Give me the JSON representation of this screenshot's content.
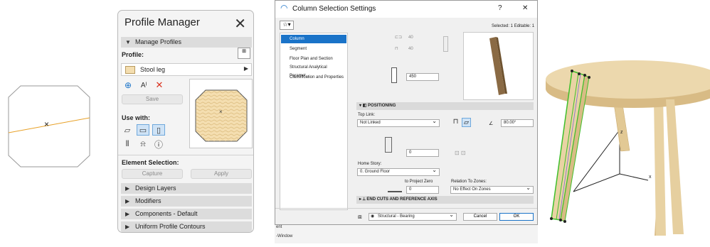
{
  "left_canvas": {
    "marker": "×"
  },
  "profile_manager": {
    "title": "Profile Manager",
    "manage_profiles": "Manage Profiles",
    "profile_label": "Profile:",
    "profile_name": "Stool leg",
    "save_label": "Save",
    "use_with_label": "Use with:",
    "element_selection_label": "Element Selection:",
    "capture_label": "Capture",
    "apply_label": "Apply",
    "sections": [
      "Design Layers",
      "Modifiers",
      "Components - Default",
      "Uniform Profile Contours"
    ],
    "preview_marker": "×"
  },
  "column_settings": {
    "title": "Column Selection Settings",
    "help": "?",
    "close": "✕",
    "selected_info": "Selected: 1 Editable: 1",
    "nav": [
      "Column",
      "Segment",
      "Floor Plan and Section",
      "Structural Analytical Paramet...",
      "Classification and Properties"
    ],
    "dim_a": "40",
    "dim_b": "40",
    "height_value": "450",
    "positioning_label": "POSITIONING",
    "top_link_label": "Top Link:",
    "top_link_value": "Not Linked",
    "angle_value": "80.00°",
    "bottom_offset": "0",
    "home_story_label": "Home Story:",
    "home_story_value": "0. Ground Floor",
    "to_project_zero": "to Project Zero",
    "project_zero_value": "0",
    "relation_label": "Relation To Zones:",
    "relation_value": "No Effect On Zones",
    "end_cuts_label": "END CUTS AND REFERENCE AXIS",
    "structural_value": "Structural - Bearing",
    "cancel_label": "Cancel",
    "ok_label": "OK"
  },
  "background_text": {
    "line1": "ent",
    "line2": "-Window"
  },
  "view3d": {
    "axis_z": "z",
    "axis_x": "x"
  },
  "colors": {
    "accent": "#1a73c8",
    "selection_green": "#3fbf2a",
    "wood": "#e9d3a4",
    "profile_fill": "#f4deb0"
  }
}
